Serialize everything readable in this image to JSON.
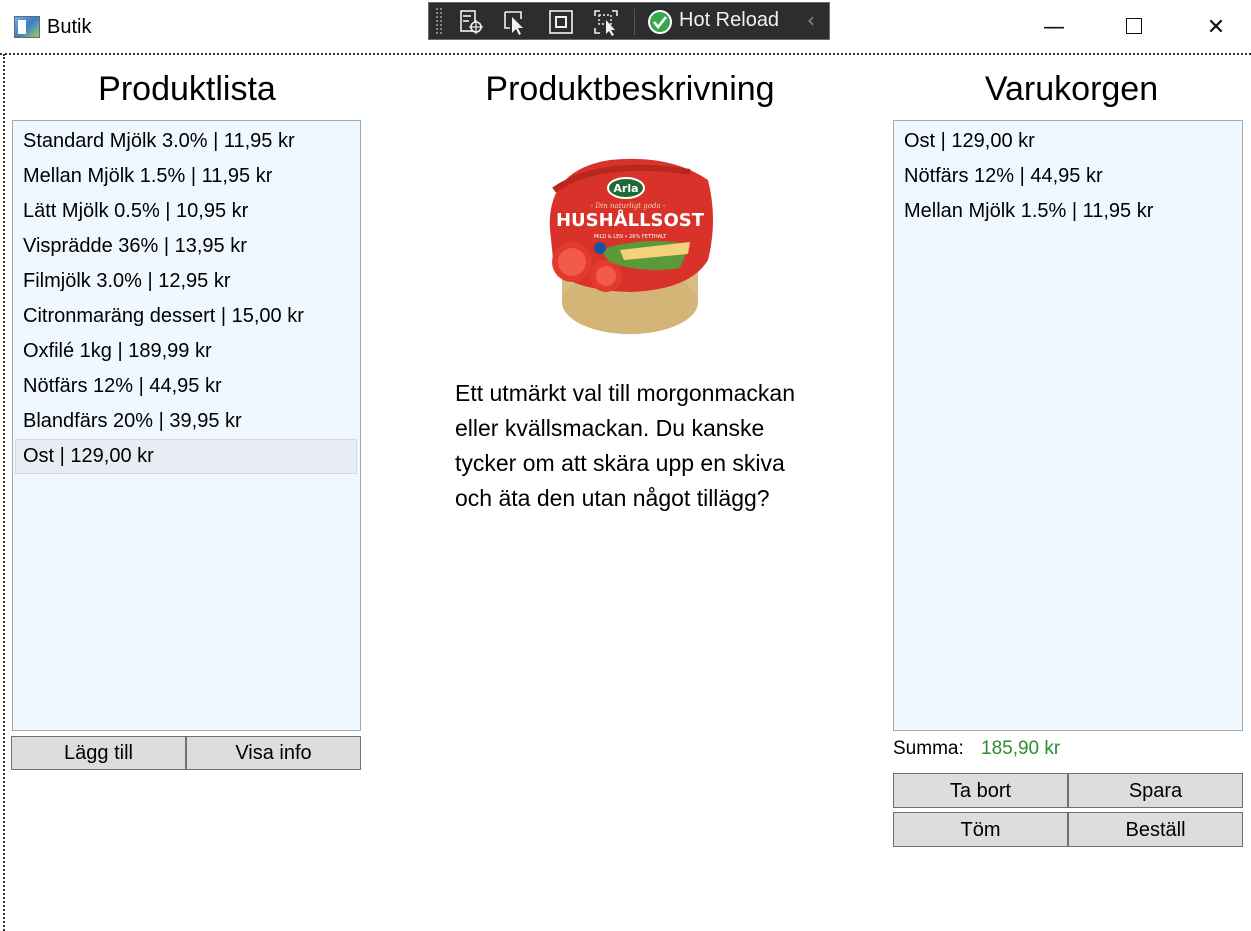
{
  "window": {
    "title": "Butik"
  },
  "devtools": {
    "hot_reload_label": "Hot Reload"
  },
  "headings": {
    "product_list": "Produktlista",
    "product_description": "Produktbeskrivning",
    "cart": "Varukorgen"
  },
  "products": [
    "Standard Mjölk 3.0% | 11,95 kr",
    "Mellan Mjölk 1.5% | 11,95 kr",
    "Lätt Mjölk 0.5% | 10,95 kr",
    "Visprädde 36% | 13,95 kr",
    "Filmjölk 3.0% | 12,95 kr",
    "Citronmaräng dessert | 15,00 kr",
    "Oxfilé 1kg | 189,99 kr",
    "Nötfärs 12% | 44,95 kr",
    "Blandfärs 20% | 39,95 kr",
    "Ost | 129,00 kr"
  ],
  "selected_product_index": 9,
  "product_buttons": {
    "add": "Lägg till",
    "info": "Visa info"
  },
  "description": "Ett utmärkt val till morgonmackan eller kvällsmackan. Du kanske tycker om att skära upp en skiva och äta den utan något tillägg?",
  "product_image": {
    "brand": "Arla",
    "name": "HUSHÅLLSOST",
    "tagline": "- Din naturligt goda -",
    "subtitle": "MILD & LEN • 26% FETTHALT"
  },
  "cart_items": [
    "Ost | 129,00 kr",
    "Nötfärs 12% | 44,95 kr",
    "Mellan Mjölk 1.5% | 11,95 kr"
  ],
  "summary": {
    "label": "Summa:",
    "value": "185,90 kr"
  },
  "cart_buttons": {
    "remove": "Ta bort",
    "save": "Spara",
    "empty": "Töm",
    "order": "Beställ"
  },
  "colors": {
    "list_background": "#f0f8ff",
    "sum_value": "#2e8b2e",
    "button_background": "#dddddd"
  }
}
